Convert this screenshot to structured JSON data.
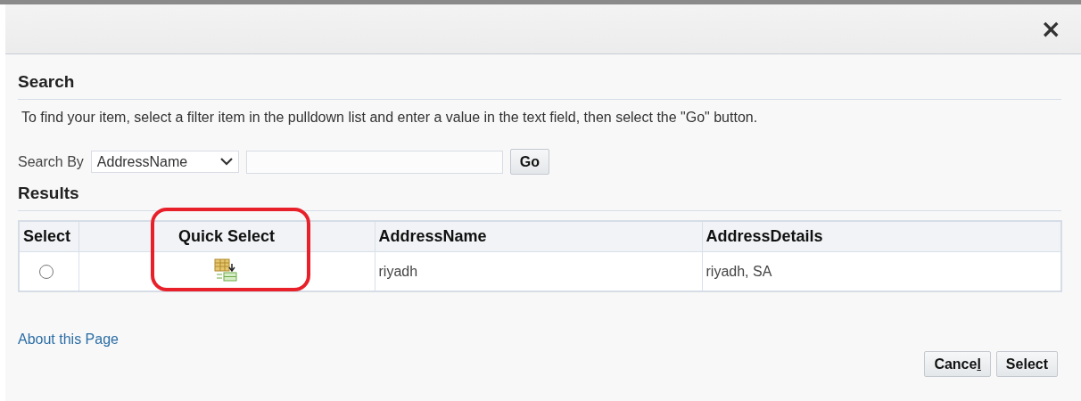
{
  "dialog": {
    "close": "×"
  },
  "search": {
    "title": "Search",
    "instructions": "To find your item, select a filter item in the pulldown list and enter a value in the text field, then select the \"Go\" button.",
    "search_by_label": "Search By",
    "filter": "AddressName",
    "go": "Go"
  },
  "results": {
    "title": "Results",
    "columns": [
      {
        "label": "Select",
        "highlighted": false
      },
      {
        "label": "Quick Select",
        "highlighted": true
      },
      {
        "label": "AddressName",
        "highlighted": false
      },
      {
        "label": "AddressDetails",
        "highlighted": false
      }
    ],
    "rows": [
      {
        "selected": false,
        "address_name": "riyadh",
        "address_details": "riyadh, SA"
      }
    ]
  },
  "about_link": "About this Page",
  "buttons": [
    {
      "label": "Cancel",
      "last_letter_underlined": true
    },
    {
      "label": "Select",
      "last_letter_underlined": false
    }
  ]
}
